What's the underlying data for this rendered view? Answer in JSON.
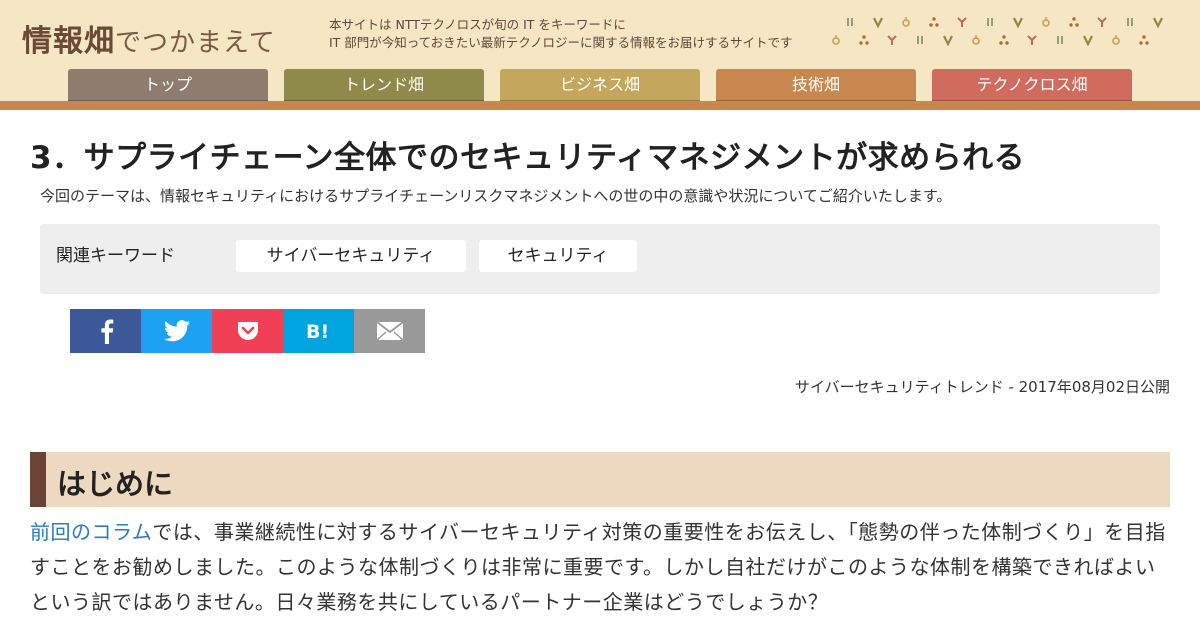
{
  "header": {
    "logo_main": "情報畑",
    "logo_sub": "でつかまえて",
    "tagline_line1": "本サイトは NTTテクノロスが旬の IT をキーワードに",
    "tagline_line2": "IT 部門が今知っておきたい最新テクノロジーに関する情報をお届けするサイトです"
  },
  "nav": {
    "tabs": [
      {
        "label": "トップ",
        "color": "#8e7d6e"
      },
      {
        "label": "トレンド畑",
        "color": "#8f8a4a"
      },
      {
        "label": "ビジネス畑",
        "color": "#c4a65c"
      },
      {
        "label": "技術畑",
        "color": "#c8874f"
      },
      {
        "label": "テクノクロス畑",
        "color": "#d06b5e"
      }
    ]
  },
  "article": {
    "title": "3．サプライチェーン全体でのセキュリティマネジメントが求められる",
    "lead": "今回のテーマは、情報セキュリティにおけるサプライチェーンリスクマネジメントへの世の中の意識や状況についてご紹介いたします。",
    "keywords_label": "関連キーワード",
    "keywords": [
      "サイバーセキュリティ",
      "セキュリティ"
    ],
    "pubdate": "サイバーセキュリティトレンド - 2017年08月02日公開"
  },
  "share": {
    "colors": {
      "facebook": "#3b5998",
      "twitter": "#1da1f2",
      "pocket": "#ef4056",
      "hatena": "#00a4de",
      "mail": "#999999"
    }
  },
  "section": {
    "heading": "はじめに",
    "link_text": "前回のコラム",
    "text_after_link": "では、事業継続性に対するサイバーセキュリティ対策の重要性をお伝えし、「態勢の伴った体制づくり」を目指すことをお勧めしました。このような体制づくりは非常に重要です。しかし自社だけがこのような体制を構築できればよいという訳ではありません。日々業務を共にしているパートナー企業はどうでしょうか？"
  }
}
